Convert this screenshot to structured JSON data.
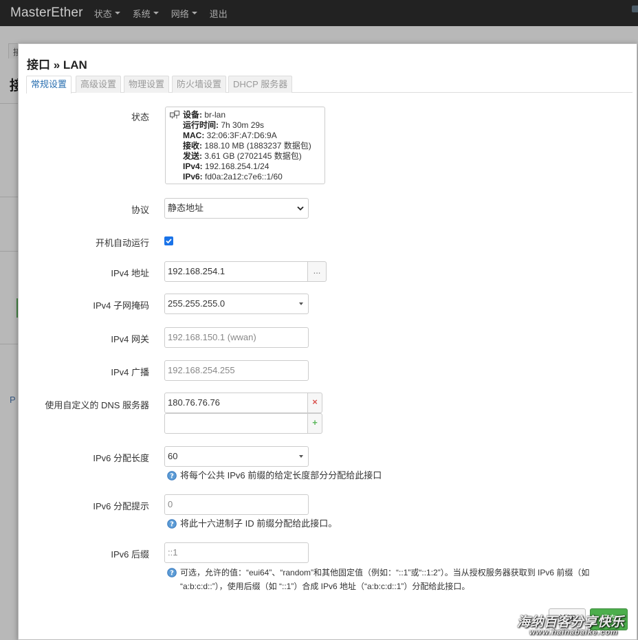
{
  "navbar": {
    "brand": "MasterEther",
    "menu": [
      {
        "label": "状态"
      },
      {
        "label": "系统"
      },
      {
        "label": "网络"
      }
    ],
    "logout": "退出"
  },
  "background": {
    "tab_fragment": "接",
    "title_fragment": "接",
    "link_fragment": "P"
  },
  "modal": {
    "title": "接口 » LAN",
    "tabs": [
      {
        "label": "常规设置",
        "active": true
      },
      {
        "label": "高级设置",
        "active": false
      },
      {
        "label": "物理设置",
        "active": false
      },
      {
        "label": "防火墙设置",
        "active": false
      },
      {
        "label": "DHCP 服务器",
        "active": false
      }
    ],
    "status": {
      "label": "状态",
      "lines": [
        {
          "key": "设备:",
          "value": "br-lan"
        },
        {
          "key": "运行时间:",
          "value": "7h 30m 29s"
        },
        {
          "key": "MAC:",
          "value": "32:06:3F:A7:D6:9A"
        },
        {
          "key": "接收:",
          "value": "188.10 MB (1883237 数据包)"
        },
        {
          "key": "发送:",
          "value": "3.61 GB (2702145 数据包)"
        },
        {
          "key": "IPv4:",
          "value": "192.168.254.1/24"
        },
        {
          "key": "IPv6:",
          "value": "fd0a:2a12:c7e6::1/60"
        }
      ]
    },
    "protocol": {
      "label": "协议",
      "value": "静态地址"
    },
    "autostart": {
      "label": "开机自动运行",
      "checked": true
    },
    "ipv4_addr": {
      "label": "IPv4 地址",
      "value": "192.168.254.1",
      "button": "..."
    },
    "ipv4_mask": {
      "label": "IPv4 子网掩码",
      "value": "255.255.255.0"
    },
    "ipv4_gw": {
      "label": "IPv4 网关",
      "placeholder": "192.168.150.1 (wwan)"
    },
    "ipv4_bc": {
      "label": "IPv4 广播",
      "placeholder": "192.168.254.255"
    },
    "dns": {
      "label": "使用自定义的 DNS 服务器",
      "value": "180.76.76.76",
      "remove": "×",
      "add": "+"
    },
    "ip6assign": {
      "label": "IPv6 分配长度",
      "value": "60",
      "help": "将每个公共 IPv6 前缀的给定长度部分分配给此接口"
    },
    "ip6hint": {
      "label": "IPv6 分配提示",
      "placeholder": "0",
      "help": "将此十六进制子 ID 前缀分配给此接口。"
    },
    "ip6suffix": {
      "label": "IPv6 后缀",
      "placeholder": "::1",
      "help_line1": "可选，允许的值：“eui64”、“random”和其他固定值（例如：“::1”或“::1:2”）。当从授权服务器获取到 IPv6 前缀（如",
      "help_line2": "“a:b:c:d::”），使用后缀（如 “::1”）合成 IPv6 地址（“a:b:c:d::1”）分配给此接口。"
    },
    "buttons": {
      "close": "关闭",
      "save": "保存"
    }
  },
  "watermark": {
    "line1": "海纳百客分享快乐",
    "line2": "www.hainabaike.com"
  },
  "colors": {
    "accent": "#1a73e8",
    "tab_active": "#2a6fb0",
    "save": "#4cae4c",
    "navbar": "#222222"
  }
}
